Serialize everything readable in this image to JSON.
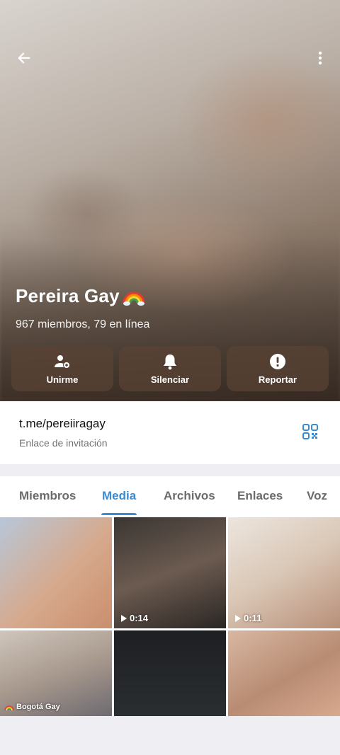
{
  "header": {
    "title": "Pereira Gay",
    "subtitle": "967 miembros, 79 en línea",
    "actions": [
      {
        "icon": "add-user-icon",
        "label": "Unirme"
      },
      {
        "icon": "bell-icon",
        "label": "Silenciar"
      },
      {
        "icon": "alert-icon",
        "label": "Reportar"
      }
    ]
  },
  "link": {
    "url": "t.me/pereiiragay",
    "caption": "Enlace de invitación"
  },
  "tabs": [
    {
      "label": "Miembros"
    },
    {
      "label": "Media"
    },
    {
      "label": "Archivos"
    },
    {
      "label": "Enlaces"
    },
    {
      "label": "Voz"
    }
  ],
  "active_tab": "Media",
  "media": [
    {
      "duration": ""
    },
    {
      "duration": "0:14"
    },
    {
      "duration": "0:11"
    },
    {
      "duration": "",
      "watermark": "Bogotá Gay"
    },
    {
      "duration": ""
    },
    {
      "duration": ""
    }
  ],
  "colors": {
    "accent": "#3a8bd6",
    "button_bg": "#5a4234"
  }
}
